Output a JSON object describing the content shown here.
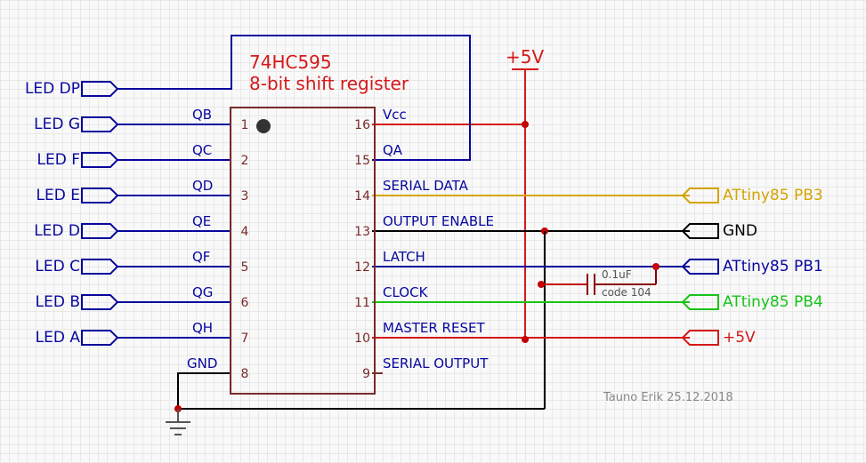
{
  "supply": {
    "plus5v": "+5V"
  },
  "chip": {
    "part": "74HC595",
    "desc": "8-bit shift register",
    "pins_left": [
      "1",
      "2",
      "3",
      "4",
      "5",
      "6",
      "7",
      "8"
    ],
    "pins_right": [
      "16",
      "15",
      "14",
      "13",
      "12",
      "11",
      "10",
      "9"
    ],
    "left_signals": [
      "QB",
      "QC",
      "QD",
      "QE",
      "QF",
      "QG",
      "QH",
      "GND"
    ],
    "right_signals": [
      "Vcc",
      "QA",
      "SERIAL DATA",
      "OUTPUT ENABLE",
      "LATCH",
      "CLOCK",
      "MASTER RESET",
      "SERIAL OUTPUT"
    ]
  },
  "left_ports": [
    "LED DP",
    "LED G",
    "LED F",
    "LED E",
    "LED D",
    "LED C",
    "LED B",
    "LED A"
  ],
  "right_ports": [
    {
      "label": "ATtiny85 PB3",
      "color": "#d4a400"
    },
    {
      "label": "GND",
      "color": "#000"
    },
    {
      "label": "ATtiny85 PB1",
      "color": "#07079e"
    },
    {
      "label": "ATtiny85 PB4",
      "color": "#18c418"
    },
    {
      "label": "+5V",
      "color": "#d51818"
    }
  ],
  "cap": {
    "value": "0.1uF",
    "code": "code 104"
  },
  "credit": "Tauno Erik 25.12.2018",
  "chart_data": {
    "type": "diagram",
    "component": "74HC595 8-bit shift register",
    "pinout": [
      {
        "pin": 1,
        "name": "QB",
        "connects": "LED G"
      },
      {
        "pin": 2,
        "name": "QC",
        "connects": "LED F"
      },
      {
        "pin": 3,
        "name": "QD",
        "connects": "LED E"
      },
      {
        "pin": 4,
        "name": "QE",
        "connects": "LED D"
      },
      {
        "pin": 5,
        "name": "QF",
        "connects": "LED C"
      },
      {
        "pin": 6,
        "name": "QG",
        "connects": "LED B"
      },
      {
        "pin": 7,
        "name": "QH",
        "connects": "LED A"
      },
      {
        "pin": 8,
        "name": "GND",
        "connects": "GND"
      },
      {
        "pin": 9,
        "name": "SERIAL OUTPUT",
        "connects": ""
      },
      {
        "pin": 10,
        "name": "MASTER RESET",
        "connects": "+5V"
      },
      {
        "pin": 11,
        "name": "CLOCK",
        "connects": "ATtiny85 PB4"
      },
      {
        "pin": 12,
        "name": "LATCH",
        "connects": "ATtiny85 PB1"
      },
      {
        "pin": 13,
        "name": "OUTPUT ENABLE",
        "connects": "GND"
      },
      {
        "pin": 14,
        "name": "SERIAL DATA",
        "connects": "ATtiny85 PB3"
      },
      {
        "pin": 15,
        "name": "QA",
        "connects": "LED DP"
      },
      {
        "pin": 16,
        "name": "Vcc",
        "connects": "+5V"
      }
    ],
    "decoupling_cap": {
      "value_uF": 0.1,
      "code": "104",
      "between": [
        "+5V",
        "GND-rail near pin13"
      ]
    }
  }
}
